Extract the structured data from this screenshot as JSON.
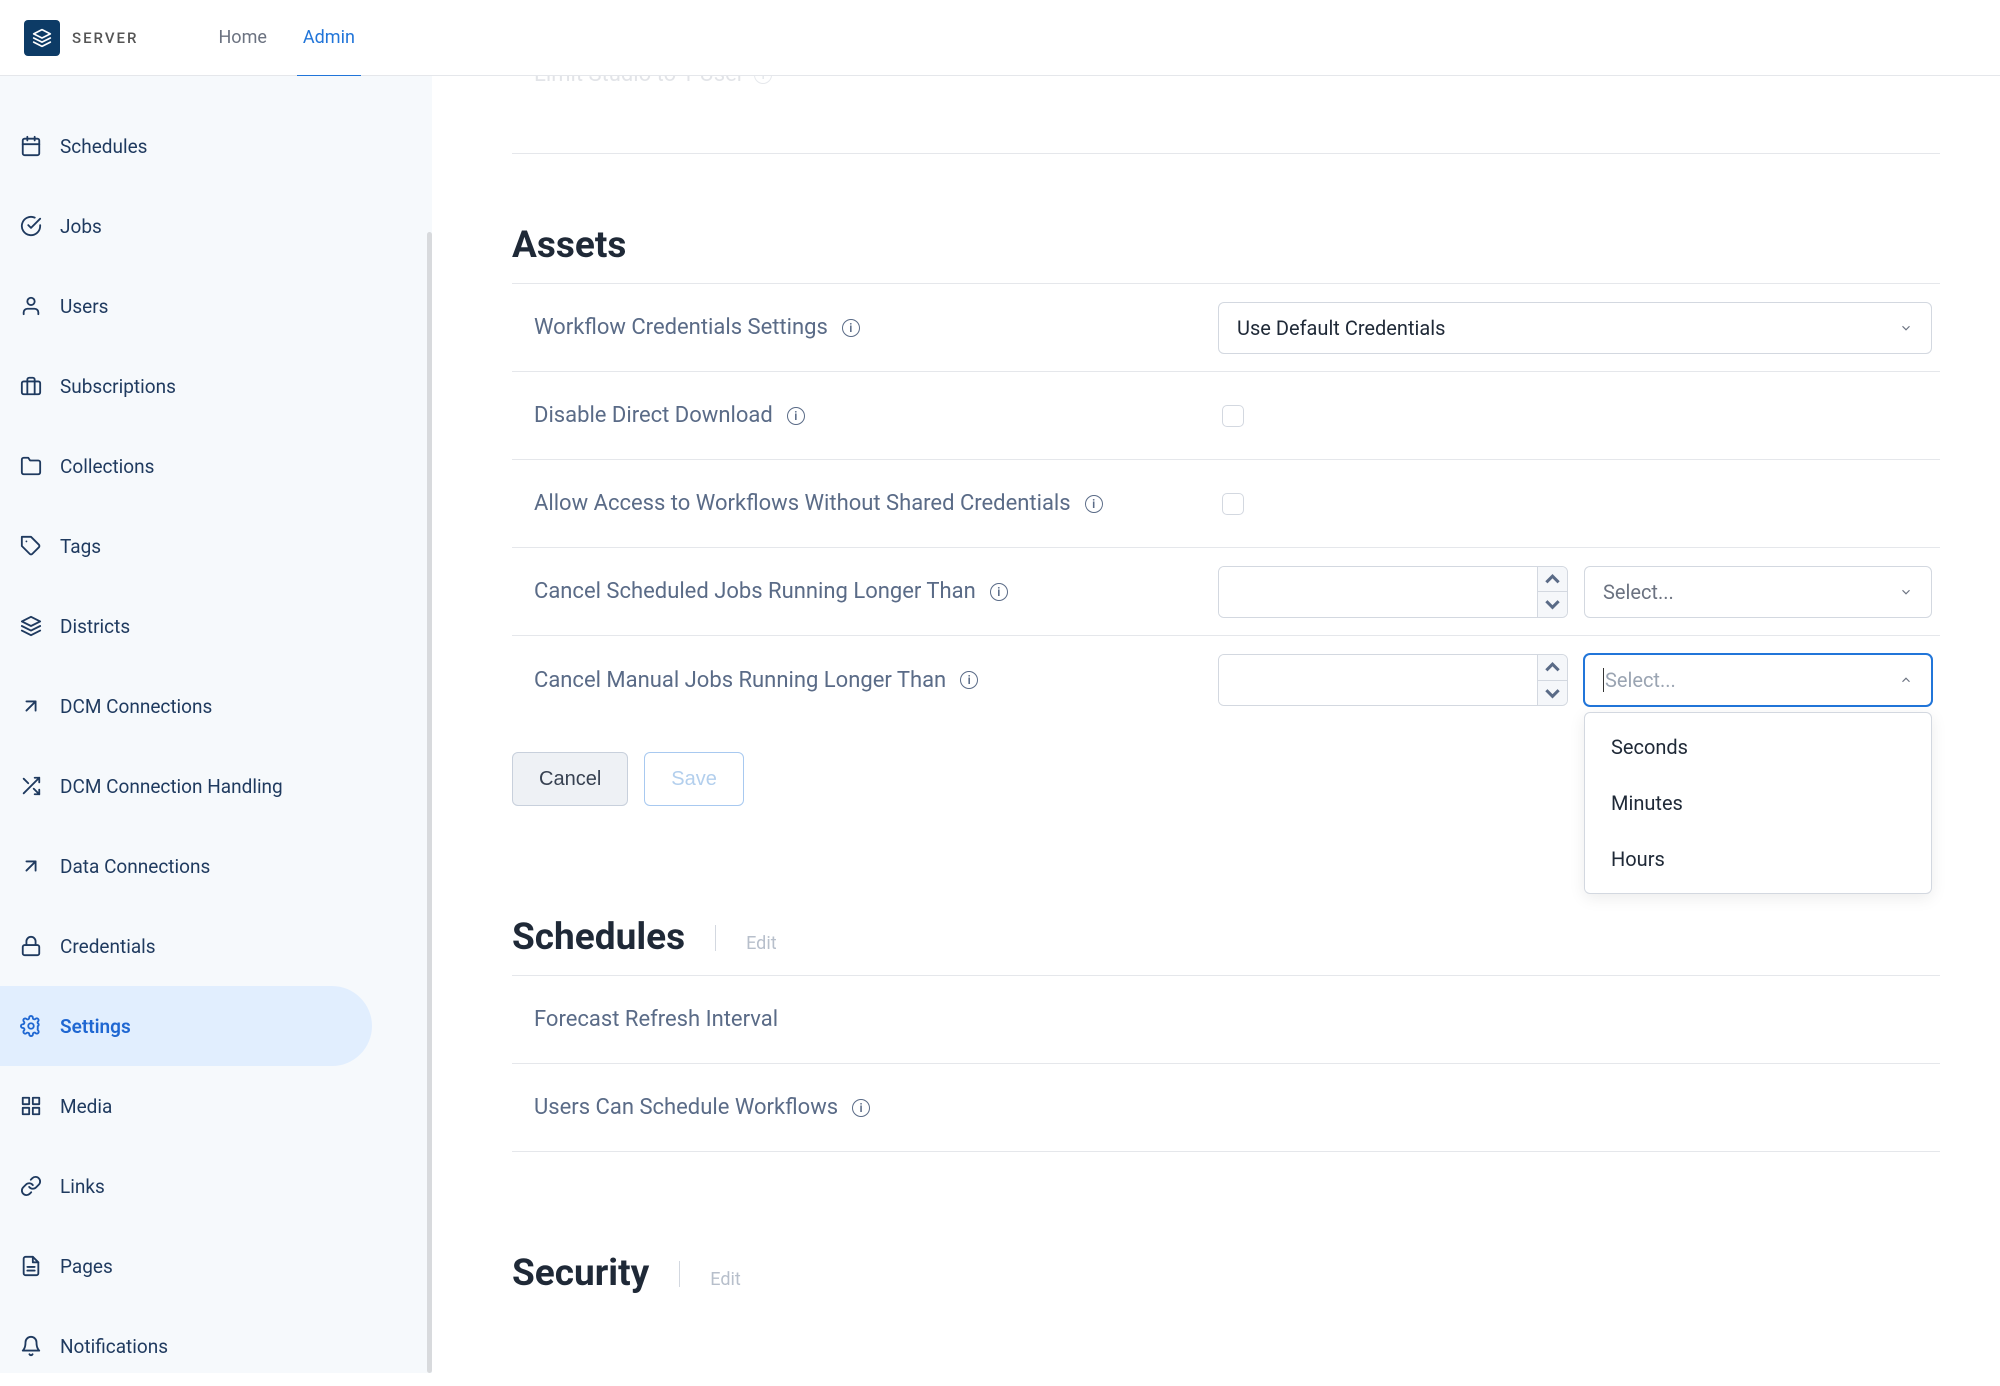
{
  "header": {
    "logo_text": "SERVER",
    "nav": [
      {
        "label": "Home",
        "active": false
      },
      {
        "label": "Admin",
        "active": true
      }
    ]
  },
  "sidebar": {
    "items": [
      {
        "id": "schedules",
        "label": "Schedules",
        "icon": "calendar-icon"
      },
      {
        "id": "jobs",
        "label": "Jobs",
        "icon": "check-circle-icon"
      },
      {
        "id": "users",
        "label": "Users",
        "icon": "user-icon"
      },
      {
        "id": "subscriptions",
        "label": "Subscriptions",
        "icon": "briefcase-icon"
      },
      {
        "id": "collections",
        "label": "Collections",
        "icon": "folder-icon"
      },
      {
        "id": "tags",
        "label": "Tags",
        "icon": "tag-icon"
      },
      {
        "id": "districts",
        "label": "Districts",
        "icon": "layers-icon"
      },
      {
        "id": "dcm-connections",
        "label": "DCM Connections",
        "icon": "arrow-up-right-icon"
      },
      {
        "id": "dcm-connection-handling",
        "label": "DCM Connection Handling",
        "icon": "shuffle-icon"
      },
      {
        "id": "data-connections",
        "label": "Data Connections",
        "icon": "arrow-up-right-icon"
      },
      {
        "id": "credentials",
        "label": "Credentials",
        "icon": "lock-icon"
      },
      {
        "id": "settings",
        "label": "Settings",
        "icon": "gear-icon",
        "active": true
      },
      {
        "id": "media",
        "label": "Media",
        "icon": "grid-icon"
      },
      {
        "id": "links",
        "label": "Links",
        "icon": "link-icon"
      },
      {
        "id": "pages",
        "label": "Pages",
        "icon": "document-icon"
      },
      {
        "id": "notifications",
        "label": "Notifications",
        "icon": "bell-icon"
      }
    ]
  },
  "sections": {
    "assets": {
      "title": "Assets",
      "rows": {
        "workflow_credentials": {
          "label": "Workflow Credentials Settings",
          "select_value": "Use Default Credentials"
        },
        "disable_download": {
          "label": "Disable Direct Download"
        },
        "allow_access": {
          "label": "Allow Access to Workflows Without Shared Credentials"
        },
        "cancel_scheduled": {
          "label": "Cancel Scheduled Jobs Running Longer Than",
          "unit_placeholder": "Select..."
        },
        "cancel_manual": {
          "label": "Cancel Manual Jobs Running Longer Than",
          "unit_placeholder": "Select...",
          "options": [
            "Seconds",
            "Minutes",
            "Hours"
          ]
        }
      },
      "actions": {
        "cancel": "Cancel",
        "save": "Save"
      }
    },
    "schedules": {
      "title": "Schedules",
      "edit": "Edit",
      "rows": {
        "forecast": {
          "label": "Forecast Refresh Interval"
        },
        "users_schedule": {
          "label": "Users Can Schedule Workflows"
        }
      }
    },
    "security": {
      "title": "Security",
      "edit": "Edit"
    }
  }
}
